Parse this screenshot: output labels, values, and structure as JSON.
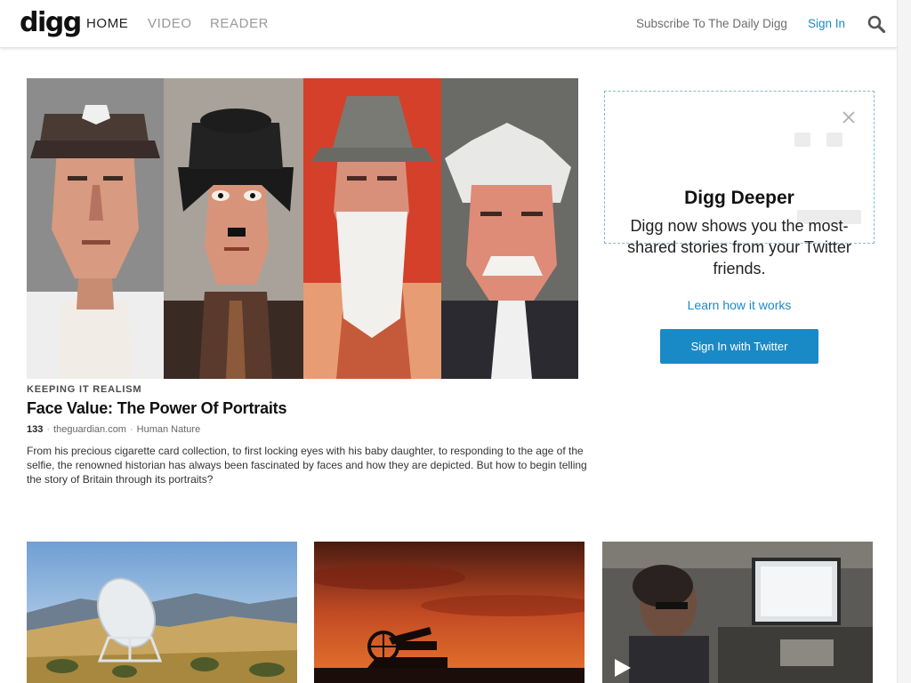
{
  "header": {
    "logo": "digg",
    "nav": [
      {
        "label": "HOME"
      },
      {
        "label": "VIDEO"
      },
      {
        "label": "READER"
      }
    ],
    "subscribe_label": "Subscribe To The Daily Digg",
    "signin_label": "Sign In"
  },
  "feature": {
    "kicker": "KEEPING IT REALISM",
    "headline": "Face Value: The Power Of Portraits",
    "digg_count": "133",
    "source": "theguardian.com",
    "category": "Human Nature",
    "summary": "From his precious cigarette card collection, to first locking eyes with his baby daughter, to responding to the age of the selfie, the renowned historian has always been fascinated by faces and how they are depicted. But how to begin telling the story of Britain through its portraits?"
  },
  "digg_deeper": {
    "title": "Digg Deeper",
    "text": "Digg now shows you the most-shared stories from your Twitter friends.",
    "learn_link": "Learn how it works",
    "button_label": "Sign In with Twitter"
  },
  "colors": {
    "accent": "#1a8ac6",
    "nav_active": "#222222",
    "nav_inactive": "#9a9a9a"
  }
}
